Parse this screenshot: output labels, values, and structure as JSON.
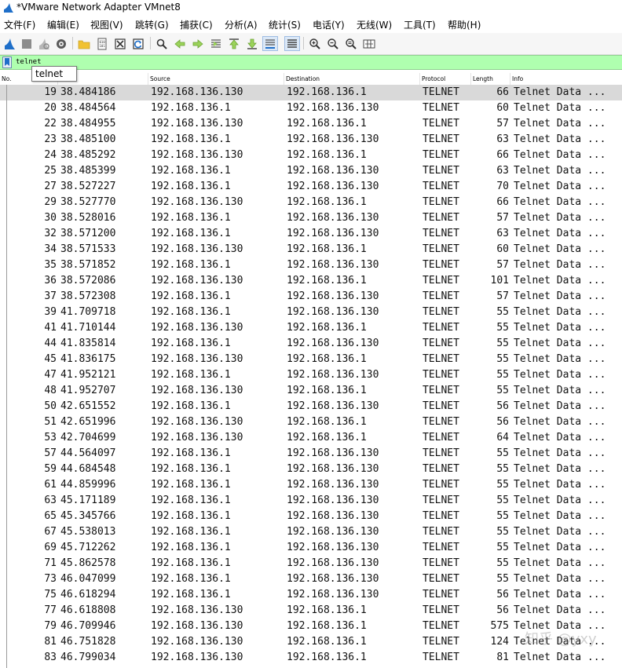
{
  "window": {
    "title": "*VMware Network Adapter VMnet8"
  },
  "menu": [
    "文件(F)",
    "编辑(E)",
    "视图(V)",
    "跳转(G)",
    "捕获(C)",
    "分析(A)",
    "统计(S)",
    "电话(Y)",
    "无线(W)",
    "工具(T)",
    "帮助(H)"
  ],
  "toolbar_icons": [
    "shark-fin-start-icon",
    "stop-square-icon",
    "restart-fin-icon",
    "options-gear-icon",
    "open-folder-icon",
    "file-binary-icon",
    "close-file-icon",
    "reload-icon",
    "find-magnifier-icon",
    "arrow-left-icon",
    "arrow-right-icon",
    "go-to-packet-icon",
    "first-packet-icon",
    "last-packet-icon",
    "autoscroll-icon",
    "colorize-icon",
    "zoom-in-icon",
    "zoom-out-icon",
    "zoom-normal-icon",
    "resize-columns-icon"
  ],
  "filter": {
    "text": "telnet"
  },
  "tooltip": {
    "text": "telnet"
  },
  "columns": {
    "no": "No.",
    "time": "Time",
    "source": "Source",
    "destination": "Destination",
    "protocol": "Protocol",
    "length": "Length",
    "info": "Info"
  },
  "packets": [
    {
      "no": "19",
      "time": "38.484186",
      "src": "192.168.136.130",
      "dst": "192.168.136.1",
      "proto": "TELNET",
      "len": "66",
      "info": "Telnet Data ..."
    },
    {
      "no": "20",
      "time": "38.484564",
      "src": "192.168.136.1",
      "dst": "192.168.136.130",
      "proto": "TELNET",
      "len": "60",
      "info": "Telnet Data ..."
    },
    {
      "no": "22",
      "time": "38.484955",
      "src": "192.168.136.130",
      "dst": "192.168.136.1",
      "proto": "TELNET",
      "len": "57",
      "info": "Telnet Data ..."
    },
    {
      "no": "23",
      "time": "38.485100",
      "src": "192.168.136.1",
      "dst": "192.168.136.130",
      "proto": "TELNET",
      "len": "63",
      "info": "Telnet Data ..."
    },
    {
      "no": "24",
      "time": "38.485292",
      "src": "192.168.136.130",
      "dst": "192.168.136.1",
      "proto": "TELNET",
      "len": "66",
      "info": "Telnet Data ..."
    },
    {
      "no": "25",
      "time": "38.485399",
      "src": "192.168.136.1",
      "dst": "192.168.136.130",
      "proto": "TELNET",
      "len": "63",
      "info": "Telnet Data ..."
    },
    {
      "no": "27",
      "time": "38.527227",
      "src": "192.168.136.1",
      "dst": "192.168.136.130",
      "proto": "TELNET",
      "len": "70",
      "info": "Telnet Data ..."
    },
    {
      "no": "29",
      "time": "38.527770",
      "src": "192.168.136.130",
      "dst": "192.168.136.1",
      "proto": "TELNET",
      "len": "66",
      "info": "Telnet Data ..."
    },
    {
      "no": "30",
      "time": "38.528016",
      "src": "192.168.136.1",
      "dst": "192.168.136.130",
      "proto": "TELNET",
      "len": "57",
      "info": "Telnet Data ..."
    },
    {
      "no": "32",
      "time": "38.571200",
      "src": "192.168.136.1",
      "dst": "192.168.136.130",
      "proto": "TELNET",
      "len": "63",
      "info": "Telnet Data ..."
    },
    {
      "no": "34",
      "time": "38.571533",
      "src": "192.168.136.130",
      "dst": "192.168.136.1",
      "proto": "TELNET",
      "len": "60",
      "info": "Telnet Data ..."
    },
    {
      "no": "35",
      "time": "38.571852",
      "src": "192.168.136.1",
      "dst": "192.168.136.130",
      "proto": "TELNET",
      "len": "57",
      "info": "Telnet Data ..."
    },
    {
      "no": "36",
      "time": "38.572086",
      "src": "192.168.136.130",
      "dst": "192.168.136.1",
      "proto": "TELNET",
      "len": "101",
      "info": "Telnet Data ..."
    },
    {
      "no": "37",
      "time": "38.572308",
      "src": "192.168.136.1",
      "dst": "192.168.136.130",
      "proto": "TELNET",
      "len": "57",
      "info": "Telnet Data ..."
    },
    {
      "no": "39",
      "time": "41.709718",
      "src": "192.168.136.1",
      "dst": "192.168.136.130",
      "proto": "TELNET",
      "len": "55",
      "info": "Telnet Data ..."
    },
    {
      "no": "41",
      "time": "41.710144",
      "src": "192.168.136.130",
      "dst": "192.168.136.1",
      "proto": "TELNET",
      "len": "55",
      "info": "Telnet Data ..."
    },
    {
      "no": "44",
      "time": "41.835814",
      "src": "192.168.136.1",
      "dst": "192.168.136.130",
      "proto": "TELNET",
      "len": "55",
      "info": "Telnet Data ..."
    },
    {
      "no": "45",
      "time": "41.836175",
      "src": "192.168.136.130",
      "dst": "192.168.136.1",
      "proto": "TELNET",
      "len": "55",
      "info": "Telnet Data ..."
    },
    {
      "no": "47",
      "time": "41.952121",
      "src": "192.168.136.1",
      "dst": "192.168.136.130",
      "proto": "TELNET",
      "len": "55",
      "info": "Telnet Data ..."
    },
    {
      "no": "48",
      "time": "41.952707",
      "src": "192.168.136.130",
      "dst": "192.168.136.1",
      "proto": "TELNET",
      "len": "55",
      "info": "Telnet Data ..."
    },
    {
      "no": "50",
      "time": "42.651552",
      "src": "192.168.136.1",
      "dst": "192.168.136.130",
      "proto": "TELNET",
      "len": "56",
      "info": "Telnet Data ..."
    },
    {
      "no": "51",
      "time": "42.651996",
      "src": "192.168.136.130",
      "dst": "192.168.136.1",
      "proto": "TELNET",
      "len": "56",
      "info": "Telnet Data ..."
    },
    {
      "no": "53",
      "time": "42.704699",
      "src": "192.168.136.130",
      "dst": "192.168.136.1",
      "proto": "TELNET",
      "len": "64",
      "info": "Telnet Data ..."
    },
    {
      "no": "57",
      "time": "44.564097",
      "src": "192.168.136.1",
      "dst": "192.168.136.130",
      "proto": "TELNET",
      "len": "55",
      "info": "Telnet Data ..."
    },
    {
      "no": "59",
      "time": "44.684548",
      "src": "192.168.136.1",
      "dst": "192.168.136.130",
      "proto": "TELNET",
      "len": "55",
      "info": "Telnet Data ..."
    },
    {
      "no": "61",
      "time": "44.859996",
      "src": "192.168.136.1",
      "dst": "192.168.136.130",
      "proto": "TELNET",
      "len": "55",
      "info": "Telnet Data ..."
    },
    {
      "no": "63",
      "time": "45.171189",
      "src": "192.168.136.1",
      "dst": "192.168.136.130",
      "proto": "TELNET",
      "len": "55",
      "info": "Telnet Data ..."
    },
    {
      "no": "65",
      "time": "45.345766",
      "src": "192.168.136.1",
      "dst": "192.168.136.130",
      "proto": "TELNET",
      "len": "55",
      "info": "Telnet Data ..."
    },
    {
      "no": "67",
      "time": "45.538013",
      "src": "192.168.136.1",
      "dst": "192.168.136.130",
      "proto": "TELNET",
      "len": "55",
      "info": "Telnet Data ..."
    },
    {
      "no": "69",
      "time": "45.712262",
      "src": "192.168.136.1",
      "dst": "192.168.136.130",
      "proto": "TELNET",
      "len": "55",
      "info": "Telnet Data ..."
    },
    {
      "no": "71",
      "time": "45.862578",
      "src": "192.168.136.1",
      "dst": "192.168.136.130",
      "proto": "TELNET",
      "len": "55",
      "info": "Telnet Data ..."
    },
    {
      "no": "73",
      "time": "46.047099",
      "src": "192.168.136.1",
      "dst": "192.168.136.130",
      "proto": "TELNET",
      "len": "55",
      "info": "Telnet Data ..."
    },
    {
      "no": "75",
      "time": "46.618294",
      "src": "192.168.136.1",
      "dst": "192.168.136.130",
      "proto": "TELNET",
      "len": "56",
      "info": "Telnet Data ..."
    },
    {
      "no": "77",
      "time": "46.618808",
      "src": "192.168.136.130",
      "dst": "192.168.136.1",
      "proto": "TELNET",
      "len": "56",
      "info": "Telnet Data ..."
    },
    {
      "no": "79",
      "time": "46.709946",
      "src": "192.168.136.130",
      "dst": "192.168.136.1",
      "proto": "TELNET",
      "len": "575",
      "info": "Telnet Data ..."
    },
    {
      "no": "81",
      "time": "46.751828",
      "src": "192.168.136.130",
      "dst": "192.168.136.1",
      "proto": "TELNET",
      "len": "124",
      "info": "Telnet Data ..."
    },
    {
      "no": "83",
      "time": "46.799034",
      "src": "192.168.136.130",
      "dst": "192.168.136.1",
      "proto": "TELNET",
      "len": "81",
      "info": "Telnet Data ..."
    }
  ],
  "selected_row": 0,
  "watermark": {
    "text": "知乎 @yxy"
  },
  "colors": {
    "filter_bg": "#afffaf",
    "selected_row": "#d9d9d9",
    "shark_blue": "#1f6fc9"
  }
}
